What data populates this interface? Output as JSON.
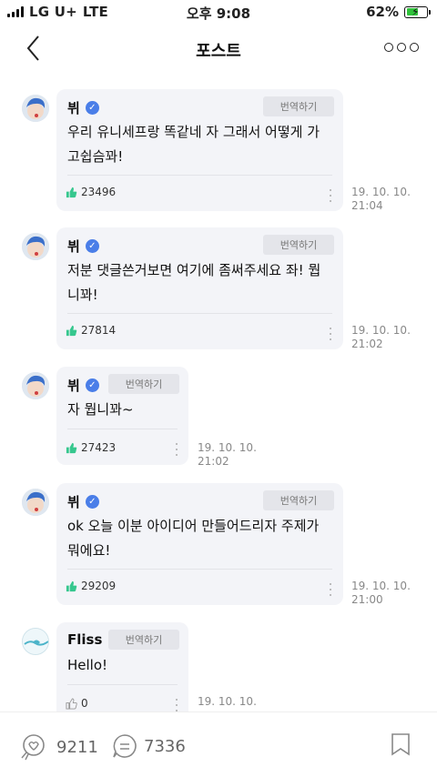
{
  "status_bar": {
    "carrier": "LG U+",
    "network": "LTE",
    "time": "오후 9:08",
    "battery": "62%",
    "battery_level": 0.62
  },
  "header": {
    "title": "포스트"
  },
  "comments": [
    {
      "author": "뷔",
      "verified": true,
      "translate_label": "번역하기",
      "text_lines": [
        "우리 유니세프랑 똑같네 자 그래서 어떻게 가",
        "고쉽슴꽈!"
      ],
      "likes": "23496",
      "date_line1": "19. 10. 10.",
      "date_line2": "21:04"
    },
    {
      "author": "뷔",
      "verified": true,
      "translate_label": "번역하기",
      "text_lines": [
        "저분 댓글쓴거보면 여기에 좀써주세요 좌! 뭡",
        "니꽈!"
      ],
      "likes": "27814",
      "date_line1": "19. 10. 10.",
      "date_line2": "21:02"
    },
    {
      "author": "뷔",
      "verified": true,
      "translate_label": "번역하기",
      "text_lines": [
        "자 뭡니꽈~"
      ],
      "likes": "27423",
      "date_line1": "19. 10. 10.",
      "date_line2": "21:02"
    },
    {
      "author": "뷔",
      "verified": true,
      "translate_label": "번역하기",
      "text_lines": [
        "ok 오늘 이분 아이디어 만들어드리자 주제가",
        "뭐에요!"
      ],
      "likes": "29209",
      "date_line1": "19. 10. 10.",
      "date_line2": "21:00"
    },
    {
      "author": "Fliss",
      "verified": false,
      "translate_label": "번역하기",
      "text_lines": [
        "Hello!"
      ],
      "likes": "0",
      "date_line1": "19. 10. 10.",
      "date_line2": ""
    }
  ],
  "bottom_bar": {
    "likes_count": "9211",
    "comments_count": "7336"
  },
  "colors": {
    "bubble": "#f3f4f8",
    "verified": "#4a7ee8",
    "like": "#36c78e",
    "battery": "#2fc23a"
  }
}
